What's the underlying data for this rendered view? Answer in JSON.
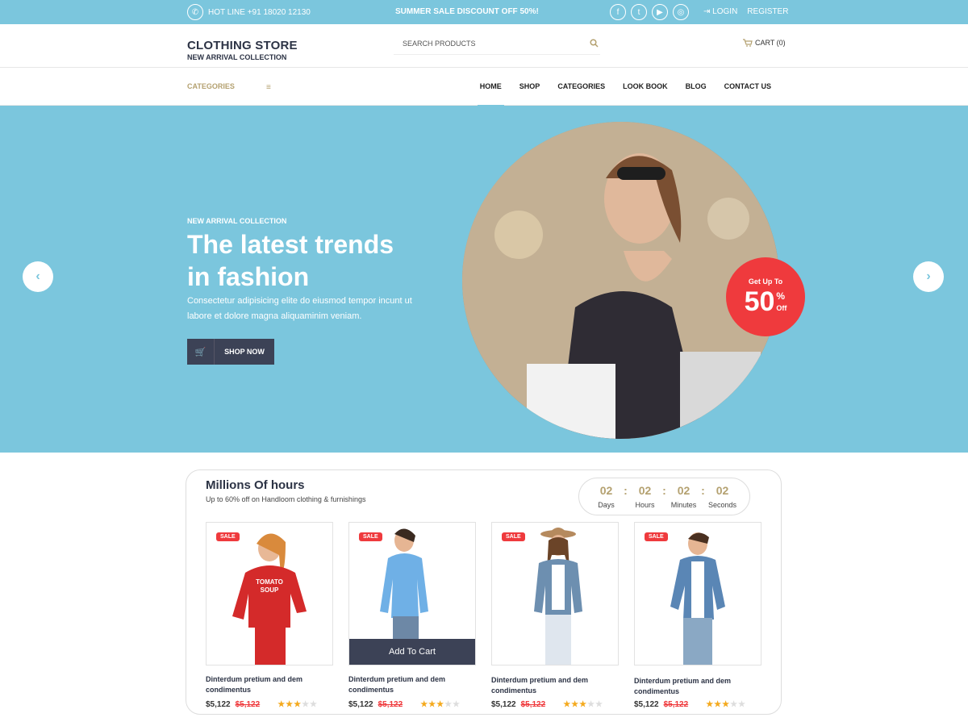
{
  "topbar": {
    "hotline": "HOT LINE +91 18020 12130",
    "promo": "SUMMER SALE DISCOUNT OFF 50%!",
    "login": "LOGIN",
    "register": "REGISTER"
  },
  "header": {
    "title": "CLOTHING STORE",
    "subtitle": "NEW ARRIVAL COLLECTION",
    "search_placeholder": "SEARCH PRODUCTS",
    "cart": "CART (0)"
  },
  "nav": {
    "categories": "CATEGORIES",
    "items": [
      "HOME",
      "SHOP",
      "CATEGORIES",
      "LOOK BOOK",
      "BLOG",
      "CONTACT US"
    ]
  },
  "hero": {
    "eyebrow": "NEW ARRIVAL COLLECTION",
    "title": "The latest trends in fashion",
    "text": "Consectetur adipisicing elite do eiusmod tempor incunt ut labore et dolore magna aliquaminim veniam.",
    "button": "SHOP NOW",
    "badge_top": "Get Up To",
    "badge_num": "50",
    "badge_pct": "%",
    "badge_off": "Off"
  },
  "deal": {
    "title": "Millions Of hours",
    "subtitle": "Up to 60% off on Handloom clothing & furnishings",
    "timer": [
      {
        "value": "02",
        "label": "Days"
      },
      {
        "value": "02",
        "label": "Hours"
      },
      {
        "value": "02",
        "label": "Minutes"
      },
      {
        "value": "02",
        "label": "Seconds"
      }
    ],
    "add_to_cart": "Add To Cart",
    "products": [
      {
        "badge": "SALE",
        "name": "Dinterdum pretium and dem condimentus",
        "price": "$5,122",
        "old": "$5,122",
        "rating": 3
      },
      {
        "badge": "SALE",
        "name": "Dinterdum pretium and dem condimentus",
        "price": "$5,122",
        "old": "$5,122",
        "rating": 3
      },
      {
        "badge": "SALE",
        "name": "Dinterdum pretium and dem condimentus",
        "price": "$5,122",
        "old": "$5,122",
        "rating": 3
      },
      {
        "badge": "SALE",
        "name": "Dinterdum pretium and dem condimentus",
        "price": "$5,122",
        "old": "$5,122",
        "rating": 3
      }
    ]
  }
}
